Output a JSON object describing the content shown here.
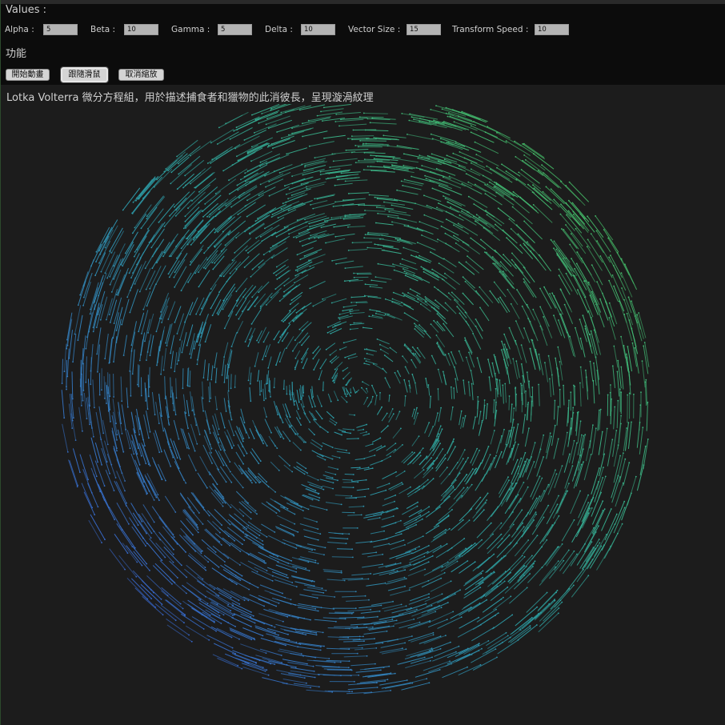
{
  "values_heading": "Values :",
  "params": [
    {
      "label": "Alpha :",
      "value": "5"
    },
    {
      "label": "Beta :",
      "value": "10"
    },
    {
      "label": "Gamma :",
      "value": "5"
    },
    {
      "label": "Delta :",
      "value": "10"
    },
    {
      "label": "Vector Size :",
      "value": "15"
    },
    {
      "label": "Transform Speed :",
      "value": "10"
    }
  ],
  "features_heading": "功能",
  "buttons": {
    "start_animation": "開始動畫",
    "follow_mouse": "跟隨滑鼠",
    "cancel_zoom": "取消縮放"
  },
  "description": "Lotka Volterra 微分方程組，用於描述捕食者和獵物的此消彼長，呈現漩渦紋理",
  "colors": {
    "background": "#1c1c1c",
    "panel": "#0c0c0c",
    "vector_blue": "#3a5fd8",
    "vector_teal": "#2fa6a0",
    "vector_green": "#4ac060"
  },
  "field_icon": "vector-field-swirl"
}
